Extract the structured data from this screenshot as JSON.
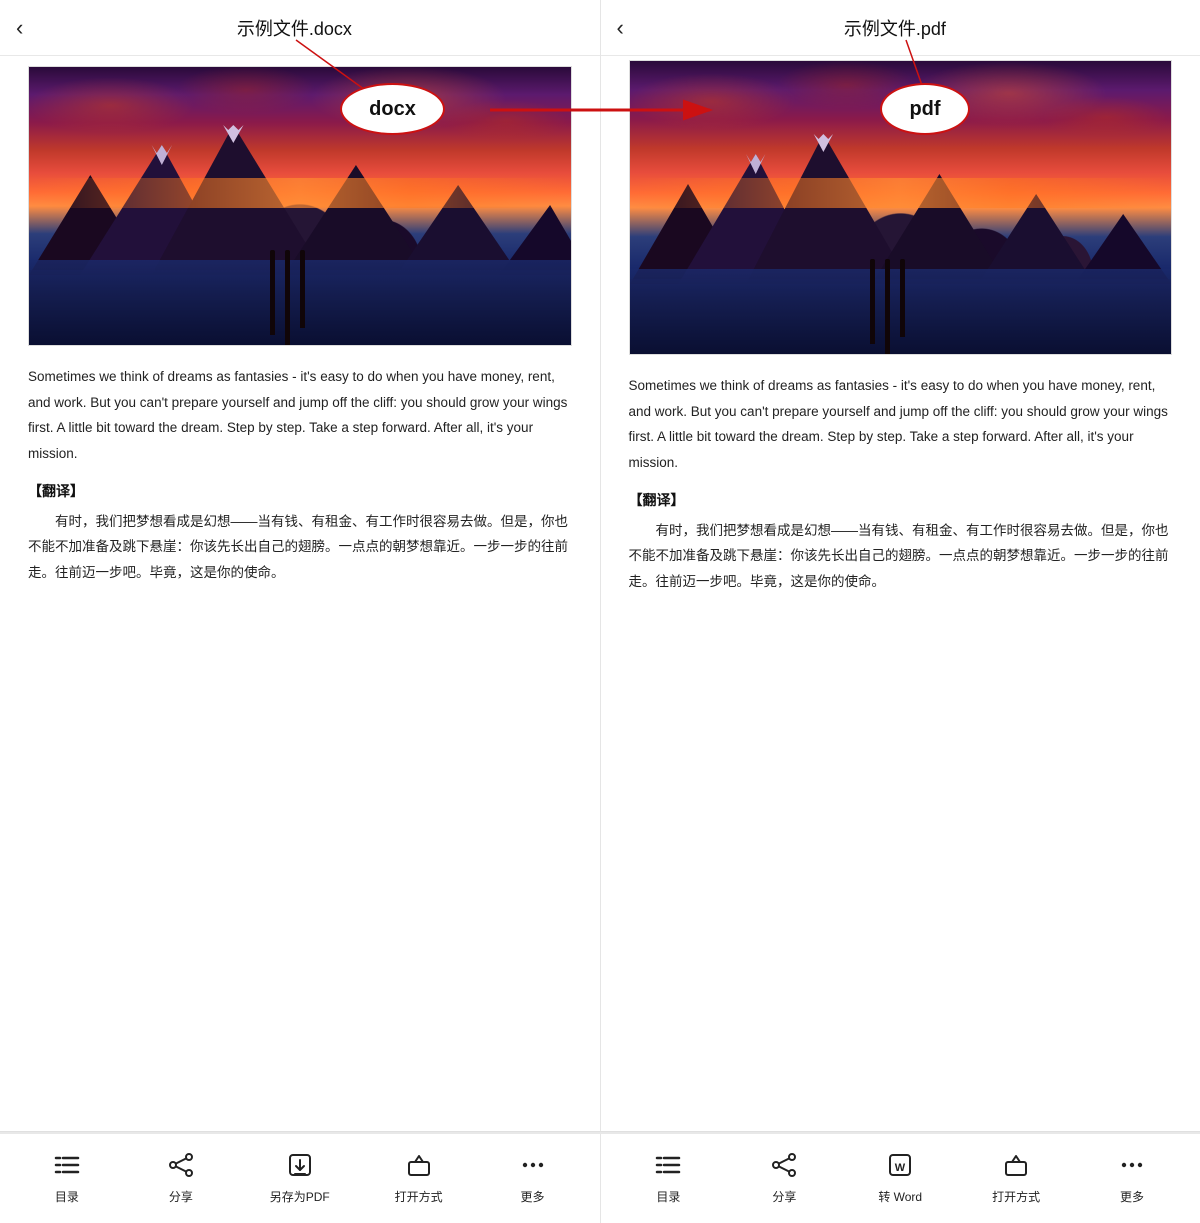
{
  "left_panel": {
    "back_label": "‹",
    "title": "示例文件.docx",
    "image_alt": "sunset mountain lake scene",
    "body_text": "Sometimes we think of dreams as fantasies - it's easy to do when you have money, rent, and work. But you can't prepare yourself and jump off the cliff: you should grow your wings first. A little bit toward the dream. Step by step. Take a step forward. After all, it's your mission.",
    "translate_label": "【翻译】",
    "translate_text": "有时，我们把梦想看成是幻想——当有钱、有租金、有工作时很容易去做。但是，你也不能不加准备及跳下悬崖：你该先长出自己的翅膀。一点点的朝梦想靠近。一步一步的往前走。往前迈一步吧。毕竟，这是你的使命。",
    "toolbar": {
      "items": [
        {
          "icon": "list",
          "label": "目录"
        },
        {
          "icon": "share",
          "label": "分享"
        },
        {
          "icon": "save-pdf",
          "label": "另存为PDF"
        },
        {
          "icon": "open-with",
          "label": "打开方式"
        },
        {
          "icon": "more",
          "label": "更多"
        }
      ]
    }
  },
  "right_panel": {
    "back_label": "‹",
    "title": "示例文件.pdf",
    "image_alt": "sunset mountain lake scene",
    "body_text": "Sometimes we think of dreams as fantasies - it's easy to do when you have money, rent, and work. But you can't prepare yourself and jump off the cliff: you should grow your wings first. A little bit toward the dream. Step by step. Take a step forward. After all, it's your mission.",
    "translate_label": "【翻译】",
    "translate_text": "有时，我们把梦想看成是幻想——当有钱、有租金、有工作时很容易去做。但是，你也不能不加准备及跳下悬崖：你该先长出自己的翅膀。一点点的朝梦想靠近。一步一步的往前走。往前迈一步吧。毕竟，这是你的使命。",
    "toolbar": {
      "items": [
        {
          "icon": "list",
          "label": "目录"
        },
        {
          "icon": "share",
          "label": "分享"
        },
        {
          "icon": "convert-word",
          "label": "转 Word"
        },
        {
          "icon": "open-with",
          "label": "打开方式"
        },
        {
          "icon": "more",
          "label": "更多"
        }
      ]
    }
  },
  "annotation": {
    "docx_label": "docx",
    "pdf_label": "pdf",
    "arrow_color": "#cc1111"
  }
}
